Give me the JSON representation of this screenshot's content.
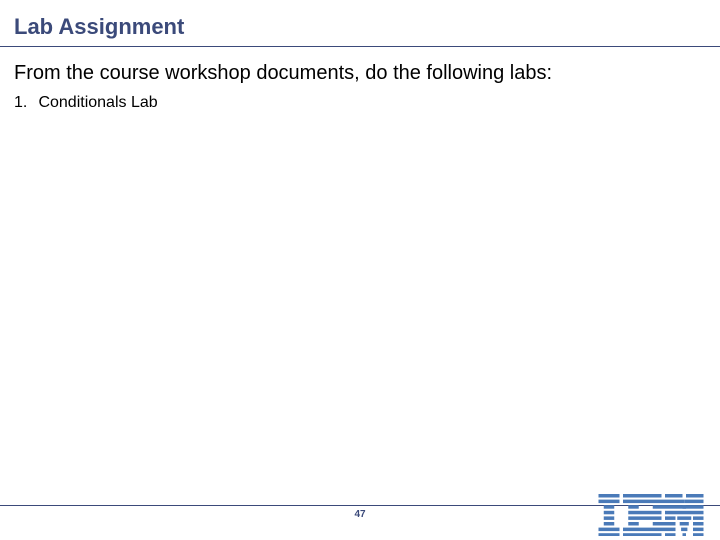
{
  "slide": {
    "title": "Lab Assignment",
    "body_intro": "From the course workshop documents, do the following labs:",
    "list_items": [
      {
        "num": "1.",
        "text": "Conditionals Lab"
      }
    ],
    "page_number": "47",
    "logo_name": "IBM"
  }
}
